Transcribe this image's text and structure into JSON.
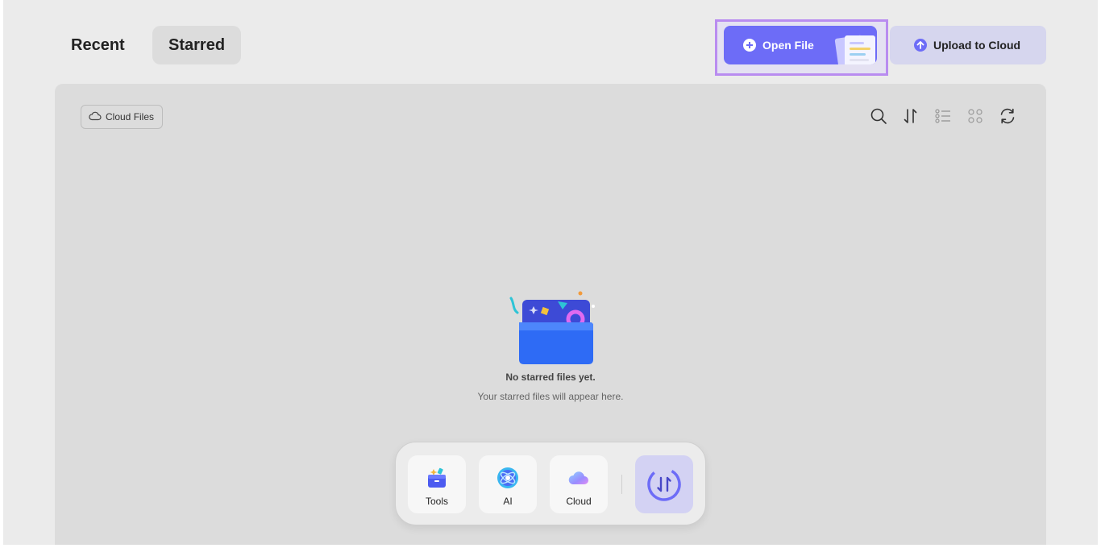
{
  "tabs": {
    "recent": "Recent",
    "starred": "Starred"
  },
  "actions": {
    "open_file": "Open File",
    "upload": "Upload to Cloud"
  },
  "panel": {
    "cloud_files": "Cloud Files",
    "toolbar_icons": [
      "search-icon",
      "sort-icon",
      "list-view-icon",
      "grid-view-icon",
      "refresh-icon"
    ],
    "empty_title": "No starred files yet.",
    "empty_subtitle": "Your starred files will appear here."
  },
  "dock": {
    "tools": "Tools",
    "ai": "AI",
    "cloud": "Cloud"
  },
  "colors": {
    "accent": "#6d6cf7",
    "highlight_border": "#b98cf0",
    "panel_bg": "#dcdcdc",
    "page_bg": "#ebebeb"
  }
}
